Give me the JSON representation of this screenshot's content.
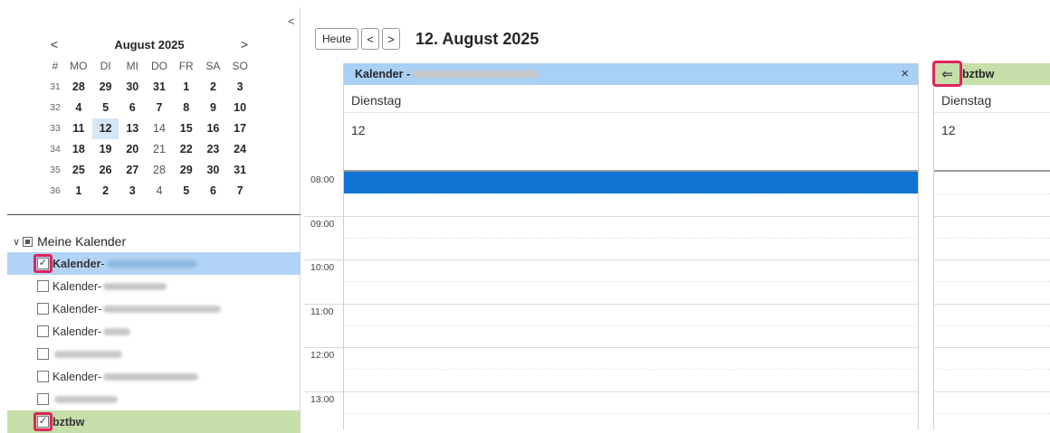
{
  "mini_calendar": {
    "prev": "<",
    "next": ">",
    "title": "August 2025",
    "collapse": "<",
    "headers": [
      "#",
      "MO",
      "DI",
      "MI",
      "DO",
      "FR",
      "SA",
      "SO"
    ],
    "weeks": [
      {
        "wk": "31",
        "days": [
          "28",
          "29",
          "30",
          "31",
          "1",
          "2",
          "3"
        ],
        "bold": [
          1,
          1,
          1,
          1,
          1,
          1,
          1
        ]
      },
      {
        "wk": "32",
        "days": [
          "4",
          "5",
          "6",
          "7",
          "8",
          "9",
          "10"
        ],
        "bold": [
          1,
          1,
          1,
          1,
          1,
          1,
          1
        ]
      },
      {
        "wk": "33",
        "days": [
          "11",
          "12",
          "13",
          "14",
          "15",
          "16",
          "17"
        ],
        "bold": [
          1,
          1,
          1,
          0,
          1,
          1,
          1
        ]
      },
      {
        "wk": "34",
        "days": [
          "18",
          "19",
          "20",
          "21",
          "22",
          "23",
          "24"
        ],
        "bold": [
          1,
          1,
          1,
          0,
          1,
          1,
          1
        ]
      },
      {
        "wk": "35",
        "days": [
          "25",
          "26",
          "27",
          "28",
          "29",
          "30",
          "31"
        ],
        "bold": [
          1,
          1,
          1,
          0,
          1,
          1,
          1
        ]
      },
      {
        "wk": "36",
        "days": [
          "1",
          "2",
          "3",
          "4",
          "5",
          "6",
          "7"
        ],
        "bold": [
          1,
          1,
          1,
          0,
          1,
          1,
          1
        ]
      }
    ],
    "today_week": 2,
    "today_col": 1
  },
  "calendars": {
    "group_label": "Meine Kalender",
    "group_chevron": "∨",
    "check": "✓",
    "items": [
      {
        "label": "Kalender",
        "sep": " -",
        "checked": true,
        "bold": true,
        "highlight": "blue",
        "blur_w": 100
      },
      {
        "label": "Kalender",
        "sep": " -",
        "checked": false,
        "bold": false,
        "highlight": "",
        "blur_w": 70
      },
      {
        "label": "Kalender",
        "sep": " -",
        "checked": false,
        "bold": false,
        "highlight": "",
        "blur_w": 130
      },
      {
        "label": "Kalender",
        "sep": " -",
        "checked": false,
        "bold": false,
        "highlight": "",
        "blur_w": 30
      },
      {
        "label": "",
        "sep": "",
        "checked": false,
        "bold": false,
        "highlight": "",
        "blur_w": 75
      },
      {
        "label": "Kalender",
        "sep": " -",
        "checked": false,
        "bold": false,
        "highlight": "",
        "blur_w": 105
      },
      {
        "label": "",
        "sep": "",
        "checked": false,
        "bold": false,
        "highlight": "",
        "blur_w": 70
      },
      {
        "label": "bztbw",
        "sep": "",
        "checked": true,
        "bold": true,
        "highlight": "green",
        "blur_w": 0
      }
    ]
  },
  "toolbar": {
    "today": "Heute",
    "prev": "<",
    "next": ">",
    "date": "12. August 2025"
  },
  "calendar_a": {
    "title": "Kalender -",
    "close": "×",
    "day_name": "Dienstag",
    "day_num": "12"
  },
  "calendar_b": {
    "title": "bztbw",
    "arrow": "⇐",
    "day_name": "Dienstag",
    "day_num": "12"
  },
  "times": [
    "08:00",
    "09:00",
    "10:00",
    "11:00",
    "12:00",
    "13:00"
  ],
  "colors": {
    "calendar_a": "#a9d0f5",
    "calendar_b": "#c6dea9",
    "event": "#0f73d4",
    "highlight": "#e0245e"
  }
}
